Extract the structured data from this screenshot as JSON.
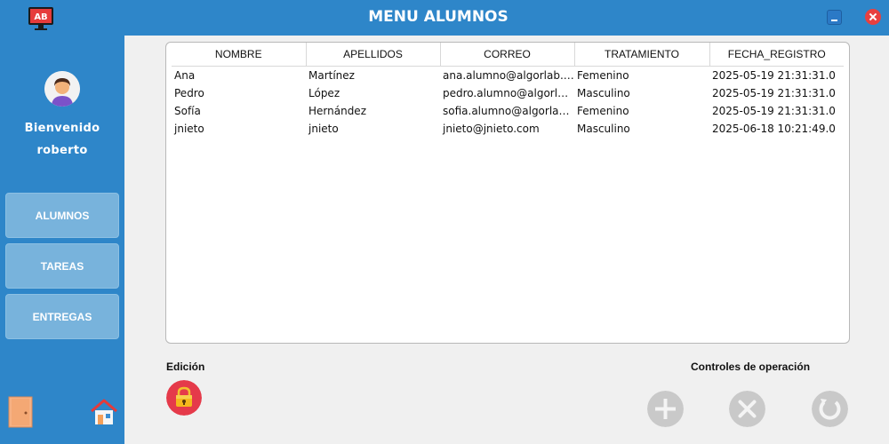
{
  "window": {
    "title": "MENU ALUMNOS",
    "logo_text": "AB"
  },
  "sidebar": {
    "welcome_line1": "Bienvenido",
    "welcome_line2": "roberto",
    "items": [
      {
        "label": "ALUMNOS"
      },
      {
        "label": "TAREAS"
      },
      {
        "label": "ENTREGAS"
      }
    ]
  },
  "table": {
    "columns": [
      "NOMBRE",
      "APELLIDOS",
      "CORREO",
      "TRATAMIENTO",
      "FECHA_REGISTRO"
    ],
    "rows": [
      [
        "Ana",
        "Martínez",
        "ana.alumno@algorlab.c...",
        "Femenino",
        "2025-05-19 21:31:31.0"
      ],
      [
        "Pedro",
        "López",
        "pedro.alumno@algorlab....",
        "Masculino",
        "2025-05-19 21:31:31.0"
      ],
      [
        "Sofía",
        "Hernández",
        "sofia.alumno@algorlab....",
        "Femenino",
        "2025-05-19 21:31:31.0"
      ],
      [
        "jnieto",
        "jnieto",
        "jnieto@jnieto.com",
        "Masculino",
        "2025-06-18 10:21:49.0"
      ]
    ]
  },
  "edition": {
    "label": "Edición"
  },
  "controls": {
    "label": "Controles de operación"
  },
  "colors": {
    "primary": "#2e86c9",
    "nav_button": "#78b3dc",
    "lock": "#e53a4a",
    "disabled": "#c9c9c9"
  },
  "icons": [
    "app-logo-icon",
    "minimize-icon",
    "close-icon",
    "avatar-icon",
    "door-icon",
    "home-icon",
    "lock-icon",
    "add-icon",
    "delete-icon",
    "refresh-icon"
  ]
}
